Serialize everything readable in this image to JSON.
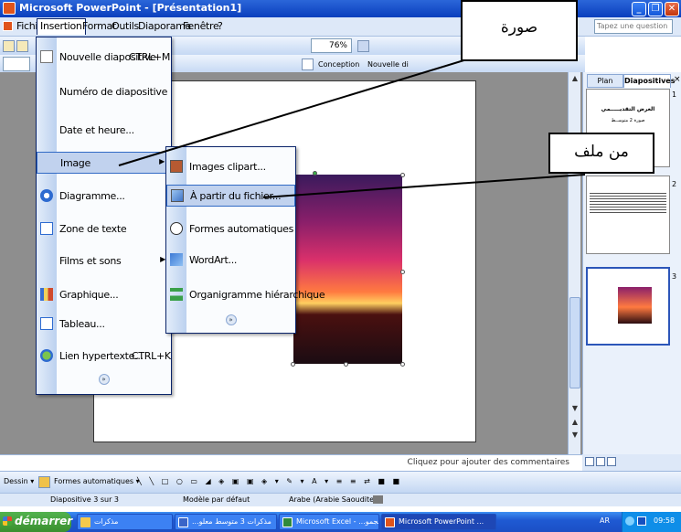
{
  "window": {
    "title": "Microsoft PowerPoint - [Présentation1]"
  },
  "menubar": {
    "items": [
      "Fichi",
      "Insertion",
      "Format",
      "Outils",
      "Diaporama",
      "Fenêtre",
      "?"
    ],
    "question_placeholder": "Tapez une question"
  },
  "toolbar": {
    "zoom": "76%",
    "conception": "Conception",
    "nouvelle": "Nouvelle di"
  },
  "insert_menu": {
    "items": [
      {
        "label": "Nouvelle diapositive",
        "shortcut": "CTRL+M"
      },
      {
        "label": "Numéro de diapositive"
      },
      {
        "label": "Date et heure..."
      },
      {
        "label": "Image"
      },
      {
        "label": "Diagramme..."
      },
      {
        "label": "Zone de texte"
      },
      {
        "label": "Films et sons"
      },
      {
        "label": "Graphique..."
      },
      {
        "label": "Tableau..."
      },
      {
        "label": "Lien hypertexte...",
        "shortcut": "CTRL+K"
      }
    ],
    "expand": "»"
  },
  "image_submenu": {
    "items": [
      {
        "label": "Images clipart..."
      },
      {
        "label": "À partir du fichier..."
      },
      {
        "label": "Formes automatiques"
      },
      {
        "label": "WordArt..."
      },
      {
        "label": "Organigramme hiérarchique"
      }
    ],
    "expand": "»"
  },
  "callouts": {
    "picture": "صورة",
    "from_file": "من ملف"
  },
  "side_panel": {
    "tabs": [
      "Plan",
      "Diapositives"
    ],
    "close": "×",
    "slides": [
      {
        "number": "1",
        "title": "العرض التقديـــــمي",
        "subtitle": "صورة 2 متوســط"
      },
      {
        "number": "2"
      },
      {
        "number": "3"
      }
    ]
  },
  "notes": {
    "placeholder": "Cliquez pour ajouter des commentaires"
  },
  "drawbar": {
    "dessin": "Dessin ▾",
    "formes": "Formes automatiques ▾"
  },
  "statusbar": {
    "slide": "Diapositive 3 sur 3",
    "design": "Modèle par défaut",
    "language": "Arabe (Arabie Saoudite)"
  },
  "taskbar": {
    "start": "démarrer",
    "tasks": [
      {
        "label": "مذكرات"
      },
      {
        "label": "...مذكرات 3 متوسط معلو"
      },
      {
        "label": "Microsoft Excel - ...مجمو"
      },
      {
        "label": "Microsoft PowerPoint ..."
      }
    ],
    "lang": "AR",
    "time": "09:58"
  },
  "colors": {
    "titlebar": "#0a3fbd",
    "menu_highlight": "#c1d2ee",
    "taskbar": "#1f5ad3",
    "start": "#3a8f2f"
  }
}
